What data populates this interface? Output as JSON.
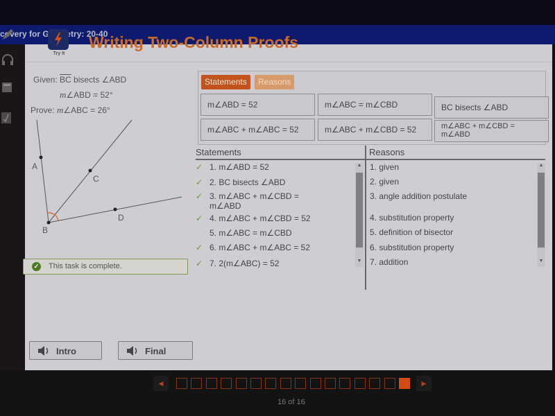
{
  "window": {
    "title": "covery for Geometry: 20-40"
  },
  "left_rail": {
    "icons": [
      "pencil-icon",
      "headphones-icon",
      "calculator-icon",
      "formula-icon"
    ]
  },
  "header": {
    "try_it_label": "Try It",
    "title": "Writing Two-Column Proofs"
  },
  "given": {
    "line1_prefix": "Given: ",
    "line1_ray": "BC",
    "line1_suffix": " bisects ∠ABD",
    "line2_m": "m",
    "line2": "∠ABD = 52°",
    "line3_prefix": "Prove: ",
    "line3_m": "m",
    "line3": "∠ABC = 26°"
  },
  "figure": {
    "points": [
      "A",
      "B",
      "C",
      "D"
    ],
    "angle_mark_color": "#d36a2a"
  },
  "status": {
    "message": "This task is complete."
  },
  "bank": {
    "tabs": [
      {
        "label": "Statements",
        "active": true
      },
      {
        "label": "Reasons",
        "active": false
      }
    ],
    "tiles": [
      "m∠ABD = 52",
      "m∠ABC = m∠CBD",
      "BC bisects ∠ABD",
      "m∠ABC + m∠ABC = 52",
      "m∠ABC + m∠CBD = 52",
      "m∠ABC + m∠CBD = m∠ABD"
    ]
  },
  "proof": {
    "statements_header": "Statements",
    "reasons_header": "Reasons",
    "rows": [
      {
        "checked": true,
        "statement": "1. m∠ABD = 52",
        "reason": "1. given"
      },
      {
        "checked": true,
        "statement": "2. BC bisects ∠ABD",
        "reason": "2. given"
      },
      {
        "checked": true,
        "statement": "3. m∠ABC + m∠CBD = m∠ABD",
        "reason": "3. angle addition postulate"
      },
      {
        "checked": true,
        "statement": "4. m∠ABC + m∠CBD = 52",
        "reason": "4. substitution property"
      },
      {
        "checked": false,
        "statement": "5. m∠ABC = m∠CBD",
        "reason": "5. definition of bisector"
      },
      {
        "checked": true,
        "statement": "6. m∠ABC + m∠ABC = 52",
        "reason": "6. substitution property"
      },
      {
        "checked": true,
        "statement": "7. 2(m∠ABC) = 52",
        "reason": "7. addition"
      }
    ]
  },
  "audio": {
    "intro_label": "Intro",
    "final_label": "Final"
  },
  "pager": {
    "total": 16,
    "current": 16,
    "text": "16 of 16"
  },
  "colors": {
    "accent": "#c3531c",
    "title": "#c86a2a",
    "title_bar": "#0d1a6e",
    "success": "#4e7a22"
  }
}
